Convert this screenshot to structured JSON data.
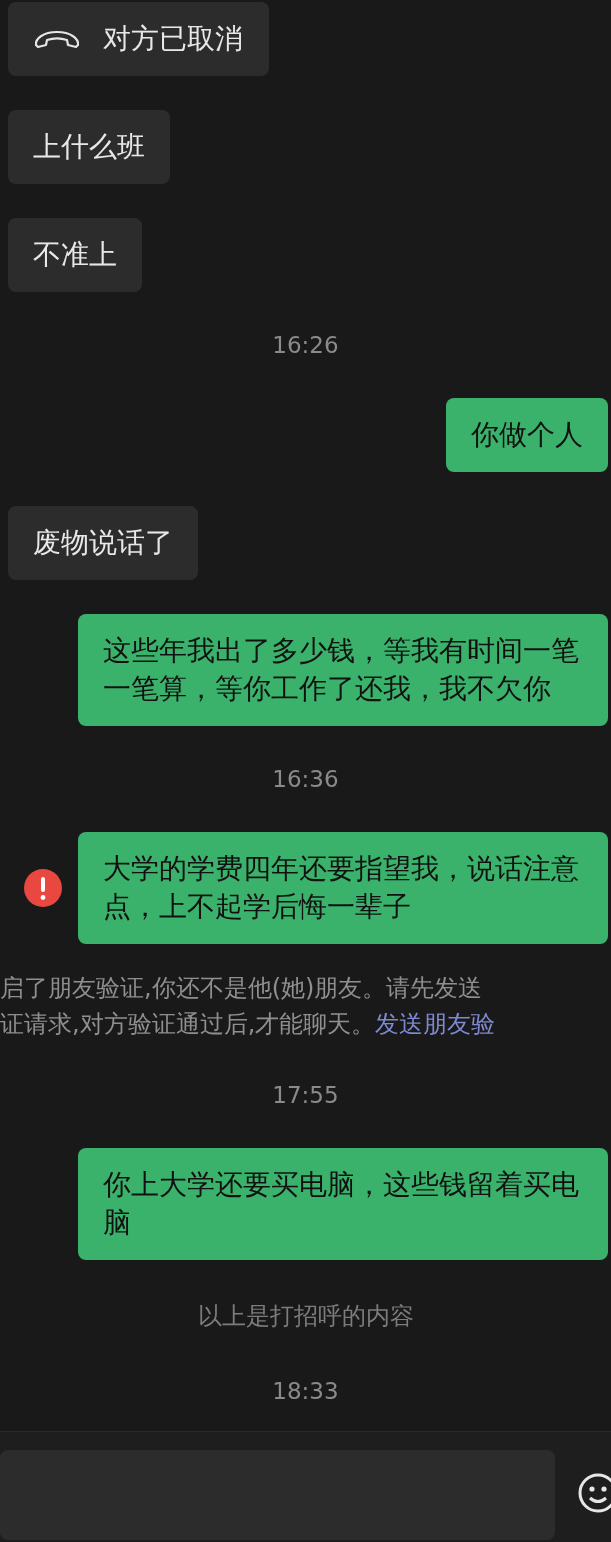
{
  "messages": [
    {
      "kind": "call",
      "outgoing": false,
      "text": "对方已取消"
    },
    {
      "kind": "text",
      "outgoing": false,
      "text": "上什么班",
      "failed": false
    },
    {
      "kind": "text",
      "outgoing": false,
      "text": "不准上",
      "failed": false
    },
    {
      "kind": "time",
      "text": "16:26"
    },
    {
      "kind": "text",
      "outgoing": true,
      "text": "你做个人",
      "failed": false
    },
    {
      "kind": "text",
      "outgoing": false,
      "text": "废物说话了",
      "failed": false
    },
    {
      "kind": "text",
      "outgoing": true,
      "text": "这些年我出了多少钱，等我有时间一笔一笔算，等你工作了还我，我不欠你",
      "failed": false
    },
    {
      "kind": "time",
      "text": "16:36"
    },
    {
      "kind": "text",
      "outgoing": true,
      "text": "大学的学费四年还要指望我，说话注意点，上不起学后悔一辈子",
      "failed": true
    },
    {
      "kind": "system",
      "lines": [
        "启了朋友验证,你还不是他(她)朋友。请先发送",
        "证请求,对方验证通过后,才能聊天。"
      ],
      "link": "发送朋友验"
    },
    {
      "kind": "time",
      "text": "17:55"
    },
    {
      "kind": "text",
      "outgoing": true,
      "text": "你上大学还要买电脑，这些钱留着买电脑",
      "failed": false
    },
    {
      "kind": "hint",
      "text": "以上是打招呼的内容"
    },
    {
      "kind": "time",
      "text": "18:33"
    }
  ]
}
